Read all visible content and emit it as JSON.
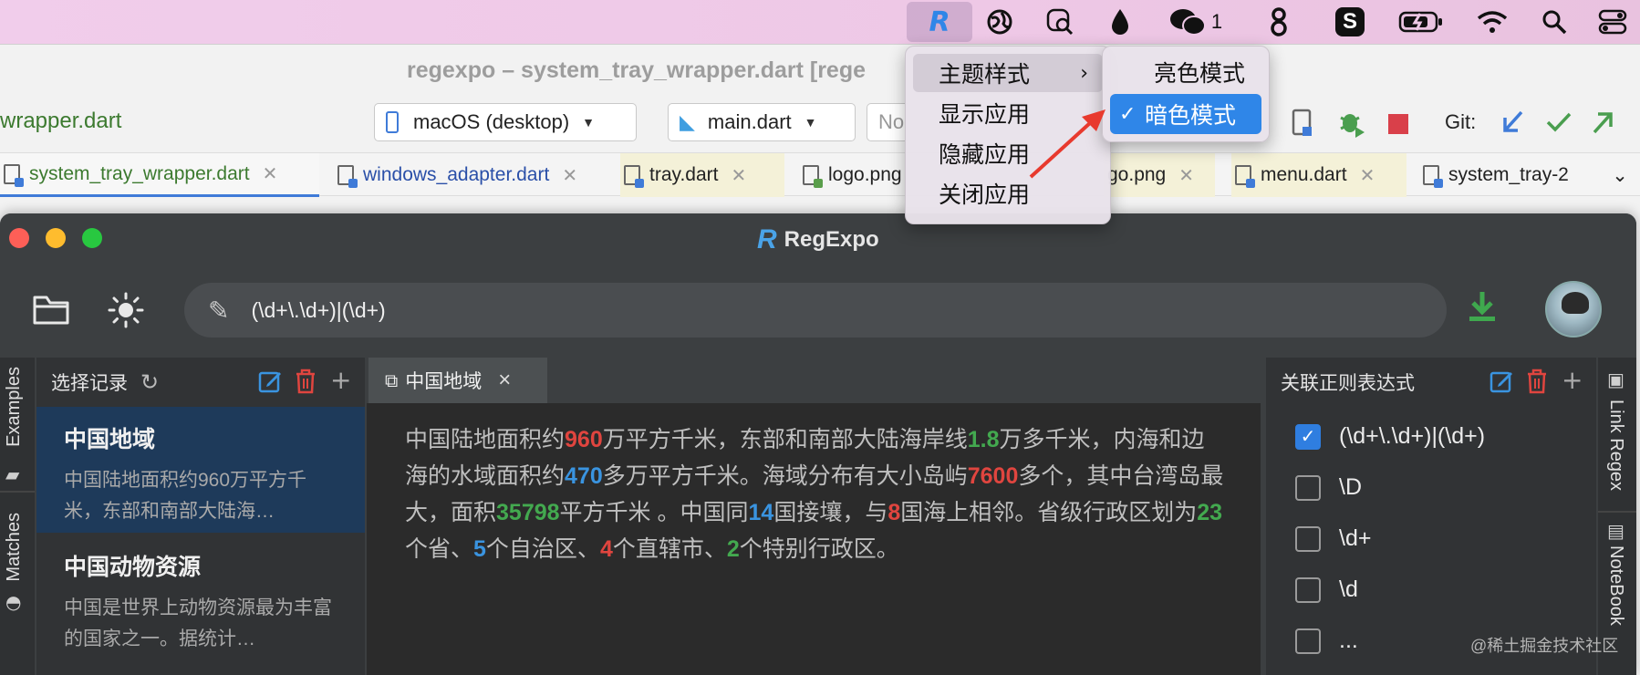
{
  "menubar": {
    "items": [
      {
        "icon": "regexpo-r-icon",
        "glyph": "Ʀ"
      },
      {
        "icon": "globe-icon",
        "glyph": "◍"
      },
      {
        "icon": "search-doc-icon",
        "glyph": "⌕"
      },
      {
        "icon": "drop-icon",
        "glyph": "●"
      },
      {
        "icon": "wechat-icon",
        "glyph": "◔",
        "count": "1"
      },
      {
        "icon": "link-icon",
        "glyph": "⛓"
      },
      {
        "icon": "s-app-icon",
        "glyph": "S"
      },
      {
        "icon": "battery-charging-icon",
        "glyph": "▭"
      },
      {
        "icon": "wifi-icon",
        "glyph": "◠"
      },
      {
        "icon": "spotlight-search-icon",
        "glyph": "⚲"
      },
      {
        "icon": "control-center-icon",
        "glyph": "◎"
      }
    ]
  },
  "tray_menu": {
    "items": [
      "主题样式",
      "显示应用",
      "隐藏应用",
      "关闭应用"
    ],
    "submenu": {
      "items": [
        "亮色模式",
        "暗色模式"
      ],
      "checked": "✓"
    }
  },
  "ide": {
    "title": "regexpo – system_tray_wrapper.dart [rege",
    "file_label": "wrapper.dart",
    "device_select": "macOS (desktop)",
    "run_config": "main.dart",
    "partial_field": "No",
    "git_label": "Git:",
    "tabs": [
      "system_tray_wrapper.dart",
      "windows_adapter.dart",
      "tray.dart",
      "logo.png",
      "go.png",
      "menu.dart",
      "system_tray-2"
    ]
  },
  "app": {
    "title": "RegExpo",
    "logo": "R",
    "regex": "(\\d+\\.\\d+)|(\\d+)",
    "left_rail": [
      "Examples",
      "Matches"
    ],
    "right_rail": [
      "Link Regex",
      "NoteBook"
    ],
    "records": {
      "heading": "选择记录",
      "items": [
        {
          "title": "中国地域",
          "desc": "中国陆地面积约960万平方千米，东部和南部大陆海…"
        },
        {
          "title": "中国动物资源",
          "desc": "中国是世界上动物资源最为丰富的国家之一。据统计…"
        }
      ]
    },
    "editor": {
      "tab": "中国地域",
      "segments": [
        {
          "t": "中国陆地面积约",
          "c": ""
        },
        {
          "t": "960",
          "c": "hl-r"
        },
        {
          "t": "万平方千米，东部和南部大陆海岸线",
          "c": ""
        },
        {
          "t": "1.8",
          "c": "hl-g"
        },
        {
          "t": "万多千米，内海和边海的水域面积约",
          "c": ""
        },
        {
          "t": "470",
          "c": "hl-b"
        },
        {
          "t": "多万平方千米。海域分布有大小岛屿",
          "c": ""
        },
        {
          "t": "7600",
          "c": "hl-r"
        },
        {
          "t": "多个，其中台湾岛最大，面积",
          "c": ""
        },
        {
          "t": "35798",
          "c": "hl-g"
        },
        {
          "t": "平方千米 。中国同",
          "c": ""
        },
        {
          "t": "14",
          "c": "hl-b"
        },
        {
          "t": "国接壤，与",
          "c": ""
        },
        {
          "t": "8",
          "c": "hl-r"
        },
        {
          "t": "国海上相邻。省级行政区划为",
          "c": ""
        },
        {
          "t": "23",
          "c": "hl-g"
        },
        {
          "t": "个省、",
          "c": ""
        },
        {
          "t": "5",
          "c": "hl-b"
        },
        {
          "t": "个自治区、",
          "c": ""
        },
        {
          "t": "4",
          "c": "hl-r"
        },
        {
          "t": "个直辖市、",
          "c": ""
        },
        {
          "t": "2",
          "c": "hl-g"
        },
        {
          "t": "个特别行政区。",
          "c": ""
        }
      ]
    },
    "link_regex": {
      "heading": "关联正则表达式",
      "items": [
        {
          "label": "(\\d+\\.\\d+)|(\\d+)",
          "checked": true
        },
        {
          "label": "\\D",
          "checked": false
        },
        {
          "label": "\\d+",
          "checked": false
        },
        {
          "label": "\\d",
          "checked": false
        },
        {
          "label": "...",
          "checked": false
        }
      ]
    },
    "watermark": "@稀土掘金技术社区"
  },
  "colors": {
    "accent": "#2f86e8",
    "red": "#e0453f",
    "green": "#43a94f",
    "blue": "#3a94e0"
  }
}
